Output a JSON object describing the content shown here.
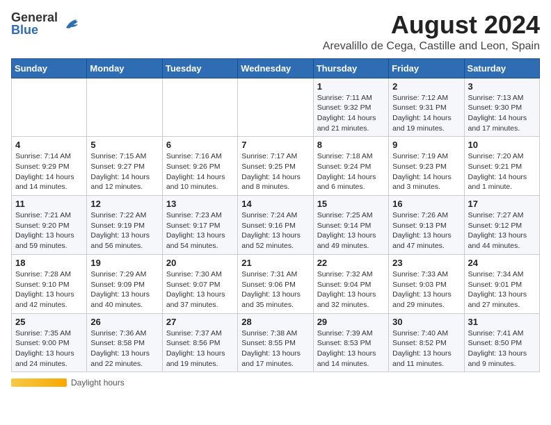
{
  "logo": {
    "general": "General",
    "blue": "Blue"
  },
  "title": "August 2024",
  "subtitle": "Arevalillo de Cega, Castille and Leon, Spain",
  "days_of_week": [
    "Sunday",
    "Monday",
    "Tuesday",
    "Wednesday",
    "Thursday",
    "Friday",
    "Saturday"
  ],
  "weeks": [
    [
      {
        "day": "",
        "info": ""
      },
      {
        "day": "",
        "info": ""
      },
      {
        "day": "",
        "info": ""
      },
      {
        "day": "",
        "info": ""
      },
      {
        "day": "1",
        "info": "Sunrise: 7:11 AM\nSunset: 9:32 PM\nDaylight: 14 hours and 21 minutes."
      },
      {
        "day": "2",
        "info": "Sunrise: 7:12 AM\nSunset: 9:31 PM\nDaylight: 14 hours and 19 minutes."
      },
      {
        "day": "3",
        "info": "Sunrise: 7:13 AM\nSunset: 9:30 PM\nDaylight: 14 hours and 17 minutes."
      }
    ],
    [
      {
        "day": "4",
        "info": "Sunrise: 7:14 AM\nSunset: 9:29 PM\nDaylight: 14 hours and 14 minutes."
      },
      {
        "day": "5",
        "info": "Sunrise: 7:15 AM\nSunset: 9:27 PM\nDaylight: 14 hours and 12 minutes."
      },
      {
        "day": "6",
        "info": "Sunrise: 7:16 AM\nSunset: 9:26 PM\nDaylight: 14 hours and 10 minutes."
      },
      {
        "day": "7",
        "info": "Sunrise: 7:17 AM\nSunset: 9:25 PM\nDaylight: 14 hours and 8 minutes."
      },
      {
        "day": "8",
        "info": "Sunrise: 7:18 AM\nSunset: 9:24 PM\nDaylight: 14 hours and 6 minutes."
      },
      {
        "day": "9",
        "info": "Sunrise: 7:19 AM\nSunset: 9:23 PM\nDaylight: 14 hours and 3 minutes."
      },
      {
        "day": "10",
        "info": "Sunrise: 7:20 AM\nSunset: 9:21 PM\nDaylight: 14 hours and 1 minute."
      }
    ],
    [
      {
        "day": "11",
        "info": "Sunrise: 7:21 AM\nSunset: 9:20 PM\nDaylight: 13 hours and 59 minutes."
      },
      {
        "day": "12",
        "info": "Sunrise: 7:22 AM\nSunset: 9:19 PM\nDaylight: 13 hours and 56 minutes."
      },
      {
        "day": "13",
        "info": "Sunrise: 7:23 AM\nSunset: 9:17 PM\nDaylight: 13 hours and 54 minutes."
      },
      {
        "day": "14",
        "info": "Sunrise: 7:24 AM\nSunset: 9:16 PM\nDaylight: 13 hours and 52 minutes."
      },
      {
        "day": "15",
        "info": "Sunrise: 7:25 AM\nSunset: 9:14 PM\nDaylight: 13 hours and 49 minutes."
      },
      {
        "day": "16",
        "info": "Sunrise: 7:26 AM\nSunset: 9:13 PM\nDaylight: 13 hours and 47 minutes."
      },
      {
        "day": "17",
        "info": "Sunrise: 7:27 AM\nSunset: 9:12 PM\nDaylight: 13 hours and 44 minutes."
      }
    ],
    [
      {
        "day": "18",
        "info": "Sunrise: 7:28 AM\nSunset: 9:10 PM\nDaylight: 13 hours and 42 minutes."
      },
      {
        "day": "19",
        "info": "Sunrise: 7:29 AM\nSunset: 9:09 PM\nDaylight: 13 hours and 40 minutes."
      },
      {
        "day": "20",
        "info": "Sunrise: 7:30 AM\nSunset: 9:07 PM\nDaylight: 13 hours and 37 minutes."
      },
      {
        "day": "21",
        "info": "Sunrise: 7:31 AM\nSunset: 9:06 PM\nDaylight: 13 hours and 35 minutes."
      },
      {
        "day": "22",
        "info": "Sunrise: 7:32 AM\nSunset: 9:04 PM\nDaylight: 13 hours and 32 minutes."
      },
      {
        "day": "23",
        "info": "Sunrise: 7:33 AM\nSunset: 9:03 PM\nDaylight: 13 hours and 29 minutes."
      },
      {
        "day": "24",
        "info": "Sunrise: 7:34 AM\nSunset: 9:01 PM\nDaylight: 13 hours and 27 minutes."
      }
    ],
    [
      {
        "day": "25",
        "info": "Sunrise: 7:35 AM\nSunset: 9:00 PM\nDaylight: 13 hours and 24 minutes."
      },
      {
        "day": "26",
        "info": "Sunrise: 7:36 AM\nSunset: 8:58 PM\nDaylight: 13 hours and 22 minutes."
      },
      {
        "day": "27",
        "info": "Sunrise: 7:37 AM\nSunset: 8:56 PM\nDaylight: 13 hours and 19 minutes."
      },
      {
        "day": "28",
        "info": "Sunrise: 7:38 AM\nSunset: 8:55 PM\nDaylight: 13 hours and 17 minutes."
      },
      {
        "day": "29",
        "info": "Sunrise: 7:39 AM\nSunset: 8:53 PM\nDaylight: 13 hours and 14 minutes."
      },
      {
        "day": "30",
        "info": "Sunrise: 7:40 AM\nSunset: 8:52 PM\nDaylight: 13 hours and 11 minutes."
      },
      {
        "day": "31",
        "info": "Sunrise: 7:41 AM\nSunset: 8:50 PM\nDaylight: 13 hours and 9 minutes."
      }
    ]
  ],
  "footer": {
    "daylight_label": "Daylight hours"
  }
}
